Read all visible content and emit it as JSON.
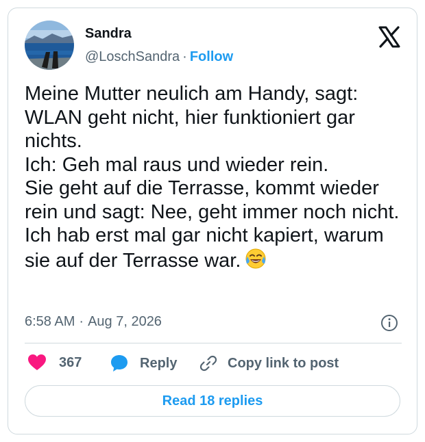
{
  "author": {
    "name": "Sandra",
    "handle": "@LoschSandra",
    "separator": "·",
    "follow_label": "Follow"
  },
  "post": {
    "text": "Meine Mutter neulich am Handy, sagt:\nWLAN geht nicht, hier funktioniert gar nichts.\nIch: Geh mal raus und wieder rein.\nSie geht auf die Terrasse, kommt wieder rein und sagt: Nee, geht immer noch nicht.\nIch hab erst mal gar nicht kapiert, warum sie auf der Terrasse war.",
    "emoji": "face-with-tears-of-joy",
    "time": "6:58 AM",
    "meta_separator": "·",
    "date": "Aug 7, 2026"
  },
  "actions": {
    "like_count": "367",
    "reply_label": "Reply",
    "copy_label": "Copy link to post"
  },
  "footer": {
    "read_replies_label": "Read 18 replies"
  },
  "icons": {
    "logo": "x-logo-icon",
    "info": "info-icon",
    "like": "heart-icon",
    "reply": "speech-bubble-icon",
    "copy": "link-icon"
  },
  "colors": {
    "accent": "#1d9bf0",
    "like": "#f91880",
    "text": "#0f1419",
    "secondary_text": "#536471",
    "border": "#cfd9de"
  }
}
